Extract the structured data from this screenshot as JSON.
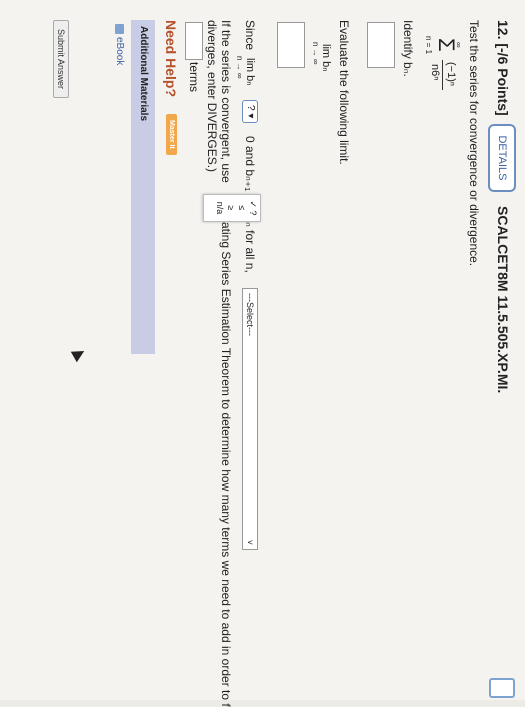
{
  "question": {
    "number": "12.",
    "points": "[-/6 Points]",
    "details_label": "DETAILS",
    "code": "SCALCET8M 11.5.505.XP.MI.",
    "prompt": "Test the series for convergence or divergence.",
    "series_top": "∞",
    "series_sigma": "Σ",
    "series_bottom": "n = 1",
    "series_numerator": "(−1)ⁿ",
    "series_denominator": "n6ⁿ",
    "identify_label": "Identify bₙ.",
    "evaluate_label": "Evaluate the following limit.",
    "lim_text": "lim  bₙ",
    "lim_sub": "n → ∞",
    "since_text": "Since",
    "since_lim": "lim  bₙ",
    "since_lim_sub": "n → ∞",
    "since_dropdown": "? ▾",
    "since_mid": "0 and bₙ₊₁",
    "since_tail": "ₙ for all n,",
    "select_placeholder": "---Select---",
    "popup_options": [
      "✓ ?",
      "≤",
      "≥",
      "n/a"
    ],
    "convergent_line1": "If the series is convergent, use",
    "convergent_line1b": "ating Series Estimation Theorem to determine how many terms we need to add in order to f",
    "convergent_line2": "diverges, enter DIVERGES.)",
    "terms_label": "terms"
  },
  "help": {
    "need_help": "Need Help?",
    "master_it": "Master It",
    "additional_materials": "Additional Materials",
    "ebook": "eBook"
  },
  "submit_label": "Submit Answer",
  "colors": {
    "accent": "#3b62a6",
    "help": "#b4512c",
    "master": "#f0a84a",
    "materials_bg": "#c8cce4"
  }
}
